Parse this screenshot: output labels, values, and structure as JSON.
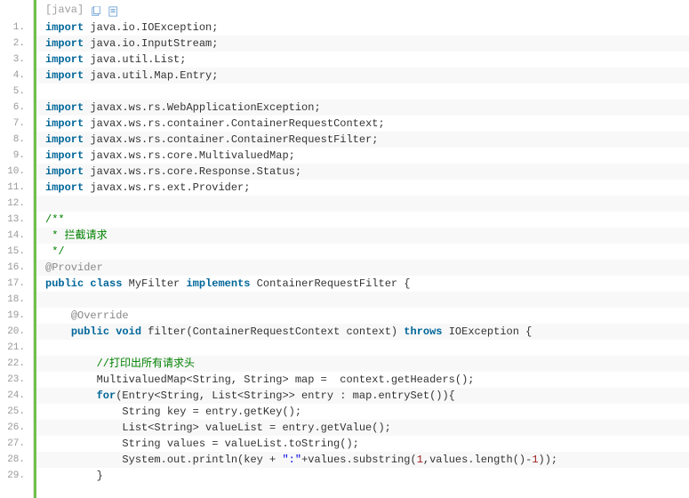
{
  "header": {
    "language_label": "[java]",
    "icon_copy": "copy-icon",
    "icon_view": "view-icon"
  },
  "lines": [
    {
      "num": "1.",
      "stripe": false,
      "segments": [
        {
          "cls": "kw",
          "t": "import"
        },
        {
          "cls": "plain",
          "t": " java.io.IOException;"
        }
      ]
    },
    {
      "num": "2.",
      "stripe": true,
      "segments": [
        {
          "cls": "kw",
          "t": "import"
        },
        {
          "cls": "plain",
          "t": " java.io.InputStream;"
        }
      ]
    },
    {
      "num": "3.",
      "stripe": false,
      "segments": [
        {
          "cls": "kw",
          "t": "import"
        },
        {
          "cls": "plain",
          "t": " java.util.List;"
        }
      ]
    },
    {
      "num": "4.",
      "stripe": true,
      "segments": [
        {
          "cls": "kw",
          "t": "import"
        },
        {
          "cls": "plain",
          "t": " java.util.Map.Entry;"
        }
      ]
    },
    {
      "num": "5.",
      "stripe": false,
      "segments": [
        {
          "cls": "plain",
          "t": ""
        }
      ]
    },
    {
      "num": "6.",
      "stripe": true,
      "segments": [
        {
          "cls": "kw",
          "t": "import"
        },
        {
          "cls": "plain",
          "t": " javax.ws.rs.WebApplicationException;"
        }
      ]
    },
    {
      "num": "7.",
      "stripe": false,
      "segments": [
        {
          "cls": "kw",
          "t": "import"
        },
        {
          "cls": "plain",
          "t": " javax.ws.rs.container.ContainerRequestContext;"
        }
      ]
    },
    {
      "num": "8.",
      "stripe": true,
      "segments": [
        {
          "cls": "kw",
          "t": "import"
        },
        {
          "cls": "plain",
          "t": " javax.ws.rs.container.ContainerRequestFilter;"
        }
      ]
    },
    {
      "num": "9.",
      "stripe": false,
      "segments": [
        {
          "cls": "kw",
          "t": "import"
        },
        {
          "cls": "plain",
          "t": " javax.ws.rs.core.MultivaluedMap;"
        }
      ]
    },
    {
      "num": "10.",
      "stripe": true,
      "segments": [
        {
          "cls": "kw",
          "t": "import"
        },
        {
          "cls": "plain",
          "t": " javax.ws.rs.core.Response.Status;"
        }
      ]
    },
    {
      "num": "11.",
      "stripe": false,
      "segments": [
        {
          "cls": "kw",
          "t": "import"
        },
        {
          "cls": "plain",
          "t": " javax.ws.rs.ext.Provider;"
        }
      ]
    },
    {
      "num": "12.",
      "stripe": true,
      "segments": [
        {
          "cls": "plain",
          "t": ""
        }
      ]
    },
    {
      "num": "13.",
      "stripe": false,
      "segments": [
        {
          "cls": "doc-comment",
          "t": "/**"
        }
      ]
    },
    {
      "num": "14.",
      "stripe": true,
      "segments": [
        {
          "cls": "doc-comment",
          "t": " * 拦截请求"
        }
      ]
    },
    {
      "num": "15.",
      "stripe": false,
      "segments": [
        {
          "cls": "doc-comment",
          "t": " */"
        }
      ]
    },
    {
      "num": "16.",
      "stripe": true,
      "segments": [
        {
          "cls": "annotation",
          "t": "@Provider"
        }
      ]
    },
    {
      "num": "17.",
      "stripe": false,
      "segments": [
        {
          "cls": "kw",
          "t": "public"
        },
        {
          "cls": "plain",
          "t": " "
        },
        {
          "cls": "kw",
          "t": "class"
        },
        {
          "cls": "plain",
          "t": " MyFilter "
        },
        {
          "cls": "kw",
          "t": "implements"
        },
        {
          "cls": "plain",
          "t": " ContainerRequestFilter {"
        }
      ]
    },
    {
      "num": "18.",
      "stripe": true,
      "segments": [
        {
          "cls": "plain",
          "t": ""
        }
      ]
    },
    {
      "num": "19.",
      "stripe": false,
      "segments": [
        {
          "cls": "plain",
          "t": "    "
        },
        {
          "cls": "annotation",
          "t": "@Override"
        }
      ]
    },
    {
      "num": "20.",
      "stripe": true,
      "segments": [
        {
          "cls": "plain",
          "t": "    "
        },
        {
          "cls": "kw",
          "t": "public"
        },
        {
          "cls": "plain",
          "t": " "
        },
        {
          "cls": "kw",
          "t": "void"
        },
        {
          "cls": "plain",
          "t": " filter(ContainerRequestContext context) "
        },
        {
          "cls": "kw",
          "t": "throws"
        },
        {
          "cls": "plain",
          "t": " IOException {"
        }
      ]
    },
    {
      "num": "21.",
      "stripe": false,
      "segments": [
        {
          "cls": "plain",
          "t": ""
        }
      ]
    },
    {
      "num": "22.",
      "stripe": true,
      "segments": [
        {
          "cls": "plain",
          "t": "        "
        },
        {
          "cls": "line-comment",
          "t": "//打印出所有请求头"
        }
      ]
    },
    {
      "num": "23.",
      "stripe": false,
      "segments": [
        {
          "cls": "plain",
          "t": "        MultivaluedMap<String, String> map =  context.getHeaders();"
        }
      ]
    },
    {
      "num": "24.",
      "stripe": true,
      "segments": [
        {
          "cls": "plain",
          "t": "        "
        },
        {
          "cls": "kw",
          "t": "for"
        },
        {
          "cls": "plain",
          "t": "(Entry<String, List<String>> entry : map.entrySet()){"
        }
      ]
    },
    {
      "num": "25.",
      "stripe": false,
      "segments": [
        {
          "cls": "plain",
          "t": "            String key = entry.getKey();"
        }
      ]
    },
    {
      "num": "26.",
      "stripe": true,
      "segments": [
        {
          "cls": "plain",
          "t": "            List<String> valueList = entry.getValue();"
        }
      ]
    },
    {
      "num": "27.",
      "stripe": false,
      "segments": [
        {
          "cls": "plain",
          "t": "            String values = valueList.toString();"
        }
      ]
    },
    {
      "num": "28.",
      "stripe": true,
      "segments": [
        {
          "cls": "plain",
          "t": "            System.out.println(key + "
        },
        {
          "cls": "str",
          "t": "\":\""
        },
        {
          "cls": "plain",
          "t": "+values.substring("
        },
        {
          "cls": "num",
          "t": "1"
        },
        {
          "cls": "plain",
          "t": ",values.length()-"
        },
        {
          "cls": "num",
          "t": "1"
        },
        {
          "cls": "plain",
          "t": "));"
        }
      ]
    },
    {
      "num": "29.",
      "stripe": false,
      "segments": [
        {
          "cls": "plain",
          "t": "        }"
        }
      ]
    }
  ]
}
